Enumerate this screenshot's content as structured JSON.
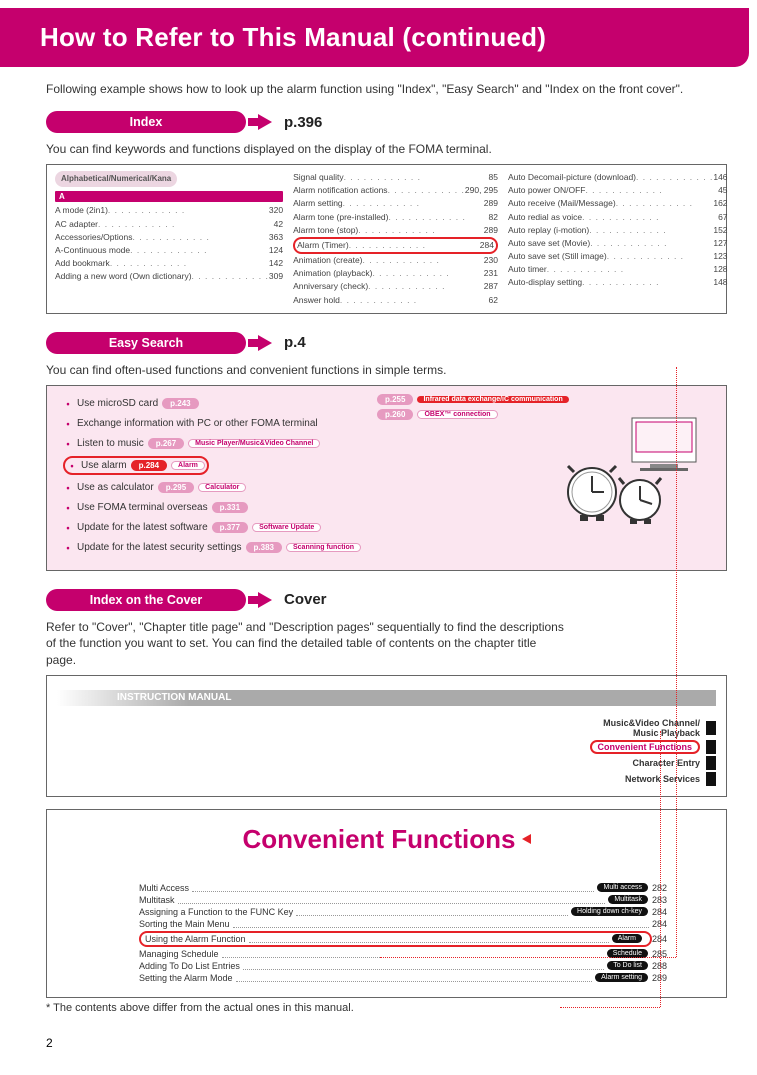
{
  "page_title": "How to Refer to This Manual (continued)",
  "intro_text": "Following example shows how to look up the alarm function using \"Index\", \"Easy Search\" and \"Index on the front cover\".",
  "sections": {
    "index": {
      "label": "Index",
      "page_ref": "p.396",
      "desc": "You can find keywords and functions displayed on the display of the FOMA terminal.",
      "col1_header": "Alphabetical/Numerical/Kana",
      "col1_letter": "A",
      "col1": [
        {
          "t": "A mode (2in1)",
          "p": "320"
        },
        {
          "t": "AC adapter",
          "p": "42"
        },
        {
          "t": "Accessories/Options",
          "p": "363"
        },
        {
          "t": "A-Continuous mode",
          "p": "124"
        },
        {
          "t": "Add bookmark",
          "p": "142"
        },
        {
          "t": "Adding a new word (Own dictionary)",
          "p": "309"
        }
      ],
      "col2": [
        {
          "t": "Signal quality",
          "p": "85"
        },
        {
          "t": "Alarm notification actions",
          "p": "290, 295"
        },
        {
          "t": "Alarm setting",
          "p": "289"
        },
        {
          "t": "Alarm tone (pre-installed)",
          "p": "82"
        },
        {
          "t": "Alarm tone (stop)",
          "p": "289"
        },
        {
          "t": "Alarm (Timer)",
          "p": "284",
          "hl": true
        },
        {
          "t": "Animation (create)",
          "p": "230"
        },
        {
          "t": "Animation (playback)",
          "p": "231"
        },
        {
          "t": "Anniversary (check)",
          "p": "287"
        },
        {
          "t": "Answer hold",
          "p": "62"
        }
      ],
      "col3": [
        {
          "t": "Auto Decomail-picture (download)",
          "p": "146"
        },
        {
          "t": "Auto power ON/OFF",
          "p": "45"
        },
        {
          "t": "Auto receive (Mail/Message)",
          "p": "162"
        },
        {
          "t": "Auto redial as voice",
          "p": "67"
        },
        {
          "t": "Auto replay (i-motion)",
          "p": "152"
        },
        {
          "t": "Auto save set (Movie)",
          "p": "127"
        },
        {
          "t": "Auto save set (Still image)",
          "p": "123"
        },
        {
          "t": "Auto timer",
          "p": "128"
        },
        {
          "t": "Auto-display setting",
          "p": "148"
        }
      ]
    },
    "easy": {
      "label": "Easy Search",
      "page_ref": "p.4",
      "desc": "You can find often-used functions and convenient functions in simple terms.",
      "lines": [
        {
          "text": "Use microSD card",
          "pg": "p.243"
        },
        {
          "text": "Exchange information with PC or other FOMA terminal"
        },
        {
          "text": "Listen to music",
          "pg": "p.267",
          "tag": "Music Player/Music&Video Channel"
        },
        {
          "text": "Use alarm",
          "pg": "p.284",
          "tag": "Alarm",
          "hl": true,
          "red": true
        },
        {
          "text": "Use as calculator",
          "pg": "p.295",
          "tag": "Calculator"
        },
        {
          "text": "Use FOMA terminal overseas",
          "pg": "p.331"
        },
        {
          "text": "Update for the latest software",
          "pg": "p.377",
          "tag": "Software Update"
        },
        {
          "text": "Update for the latest security settings",
          "pg": "p.383",
          "tag": "Scanning function"
        }
      ],
      "right_tags": [
        {
          "pg": "p.255",
          "tag": "Infrared data exchange/iC communication",
          "red": true
        },
        {
          "pg": "p.260",
          "tag": "OBEX™ connection"
        }
      ]
    },
    "cover": {
      "label": "Index on the Cover",
      "page_ref": "Cover",
      "desc": "Refer to \"Cover\", \"Chapter title page\" and \"Description pages\" sequentially to find the descriptions of the function you want to set. You can find the detailed table of contents on the chapter title page.",
      "manual_header": "INSTRUCTION MANUAL",
      "tabs": [
        {
          "t": "Music&Video Channel/\nMusic Playback"
        },
        {
          "t": "Convenient Functions",
          "hl": true
        },
        {
          "t": "Character Entry"
        },
        {
          "t": "Network Services"
        }
      ],
      "chapter_title": "Convenient Functions",
      "chapter_rows": [
        {
          "name": "Multi Access",
          "badge": "Multi access",
          "pg": "282"
        },
        {
          "name": "Multitask",
          "badge": "Multitask",
          "pg": "283"
        },
        {
          "name": "Assigning a Function to the FUNC Key",
          "badge": "Holding down ch-key",
          "pg": "284"
        },
        {
          "name": "Sorting the Main Menu",
          "badge": "",
          "pg": "284"
        },
        {
          "name": "Using the Alarm Function",
          "badge": "Alarm",
          "pg": "284",
          "hl": true
        },
        {
          "name": "Managing Schedule",
          "badge": "Schedule",
          "pg": "285"
        },
        {
          "name": "Adding To Do List Entries",
          "badge": "To Do list",
          "pg": "288"
        },
        {
          "name": "Setting the Alarm Mode",
          "badge": "Alarm setting",
          "pg": "289"
        }
      ]
    }
  },
  "footnote": "* The contents above differ from the actual ones in this manual.",
  "page_number": "2"
}
